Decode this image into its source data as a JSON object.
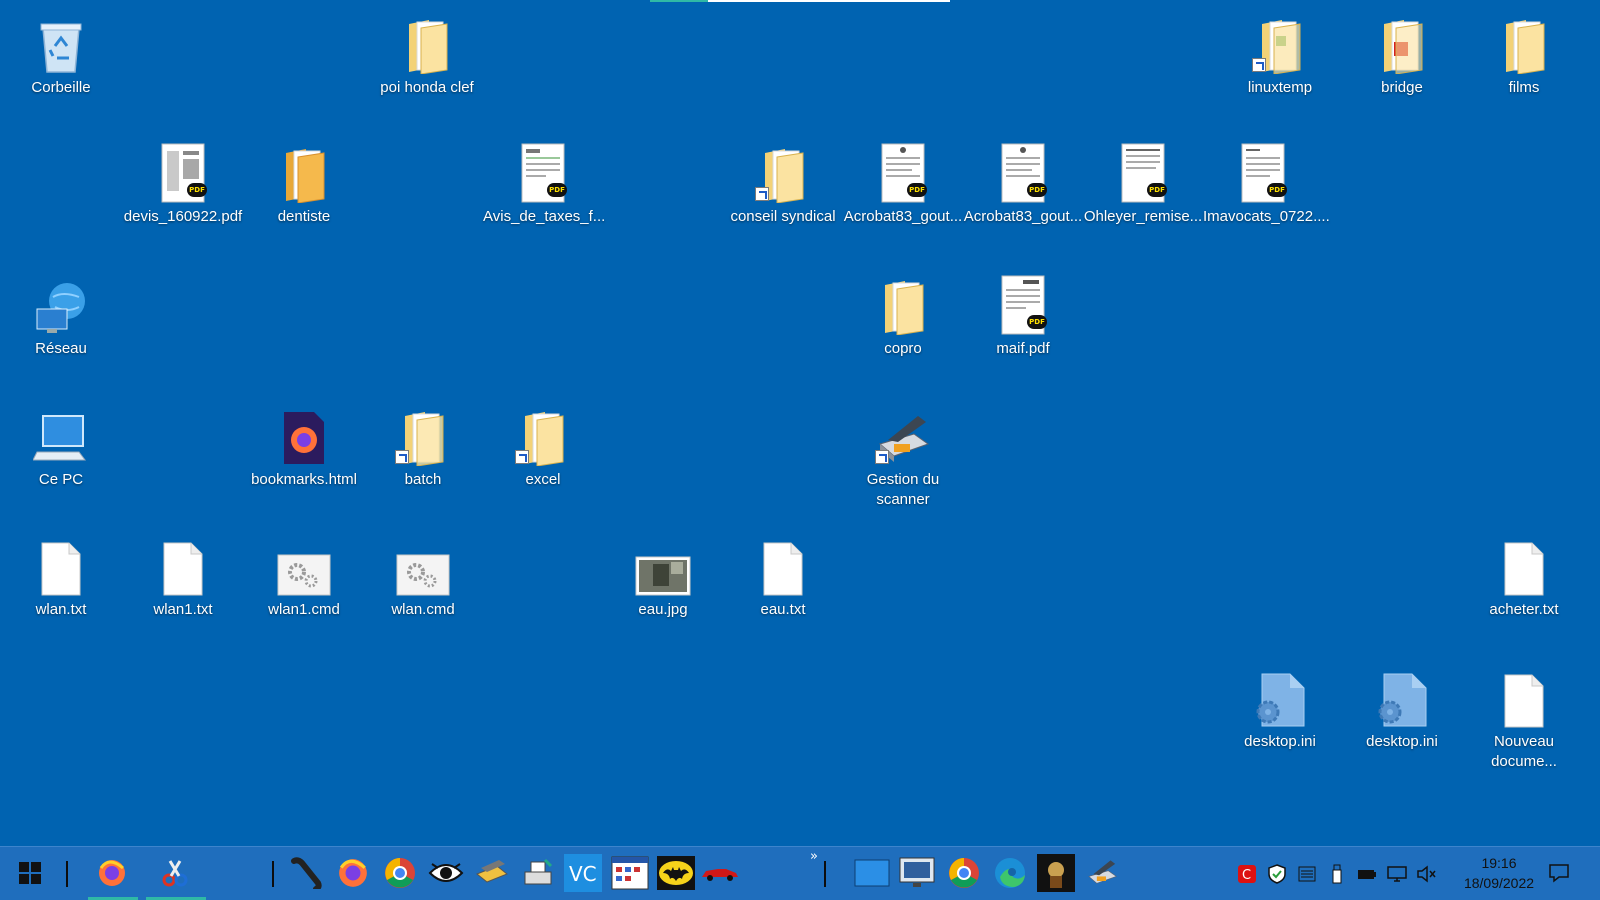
{
  "colors": {
    "desktop_bg": "#0063B1",
    "taskbar_bg": "#1f6ebd",
    "active_indicator": "#2fb9a6"
  },
  "desktop": {
    "icons": {
      "corbeille": {
        "label": "Corbeille",
        "icon": "recycle-bin-icon"
      },
      "poi_honda_clef": {
        "label": "poi honda clef",
        "icon": "folder-icon"
      },
      "linuxtemp": {
        "label": "linuxtemp",
        "icon": "folder-shortcut-icon"
      },
      "bridge": {
        "label": "bridge",
        "icon": "folder-pdf-icon"
      },
      "films": {
        "label": "films",
        "icon": "folder-icon"
      },
      "devis": {
        "label": "devis_160922.pdf",
        "icon": "pdf-file-icon"
      },
      "dentiste": {
        "label": "dentiste",
        "icon": "folder-icon"
      },
      "avis": {
        "label": "Avis_de_taxes_f...",
        "icon": "pdf-file-icon"
      },
      "conseil": {
        "label": "conseil syndical",
        "icon": "folder-shortcut-icon"
      },
      "acrobat1": {
        "label": "Acrobat83_gout...",
        "icon": "pdf-file-icon"
      },
      "acrobat2": {
        "label": "Acrobat83_gout...",
        "icon": "pdf-file-icon"
      },
      "ohleyer": {
        "label": "Ohleyer_remise...",
        "icon": "pdf-file-icon"
      },
      "imavocats": {
        "label": "Imavocats_0722....",
        "icon": "pdf-file-icon"
      },
      "reseau": {
        "label": "Réseau",
        "icon": "network-icon"
      },
      "copro": {
        "label": "copro",
        "icon": "folder-icon"
      },
      "maif": {
        "label": "maif.pdf",
        "icon": "pdf-file-icon"
      },
      "cepc": {
        "label": "Ce PC",
        "icon": "computer-icon"
      },
      "bookmarks": {
        "label": "bookmarks.html",
        "icon": "firefox-html-icon"
      },
      "batch": {
        "label": "batch",
        "icon": "folder-shortcut-icon"
      },
      "excel": {
        "label": "excel",
        "icon": "folder-shortcut-icon"
      },
      "scanner": {
        "label": "Gestion du scanner",
        "icon": "scanner-shortcut-icon"
      },
      "wlan_txt": {
        "label": "wlan.txt",
        "icon": "text-file-icon"
      },
      "wlan1_txt": {
        "label": "wlan1.txt",
        "icon": "text-file-icon"
      },
      "wlan1_cmd": {
        "label": "wlan1.cmd",
        "icon": "cmd-file-icon"
      },
      "wlan_cmd": {
        "label": "wlan.cmd",
        "icon": "cmd-file-icon"
      },
      "eau_jpg": {
        "label": "eau.jpg",
        "icon": "image-file-icon"
      },
      "eau_txt": {
        "label": "eau.txt",
        "icon": "text-file-icon"
      },
      "acheter": {
        "label": "acheter.txt",
        "icon": "text-file-icon"
      },
      "desktop_ini1": {
        "label": "desktop.ini",
        "icon": "settings-file-icon"
      },
      "desktop_ini2": {
        "label": "desktop.ini",
        "icon": "settings-file-icon"
      },
      "nouveau": {
        "label": "Nouveau docume...",
        "icon": "text-file-icon"
      }
    }
  },
  "taskbar": {
    "start_icon": "windows-start-icon",
    "pinned": [
      "firefox-icon",
      "snipping-tool-icon",
      "phone-handset-icon",
      "firefox-icon",
      "chrome-icon",
      "eye-icon",
      "scanner-app-icon",
      "print-app-icon",
      "vc-app-icon",
      "calendar-app-icon",
      "batman-icon",
      "red-car-icon",
      "desktop-window-icon",
      "monitor-app-icon",
      "chrome-icon",
      "edge-icon",
      "dark-app-icon",
      "scanner-icon"
    ],
    "overflow_label": "»",
    "tray": [
      "antivirus-icon",
      "security-shield-icon",
      "settings-panel-icon",
      "usb-icon",
      "battery-icon",
      "network-status-icon",
      "volume-muted-icon"
    ],
    "clock": {
      "time": "19:16",
      "date": "18/09/2022"
    },
    "notifications_icon": "notifications-icon"
  }
}
